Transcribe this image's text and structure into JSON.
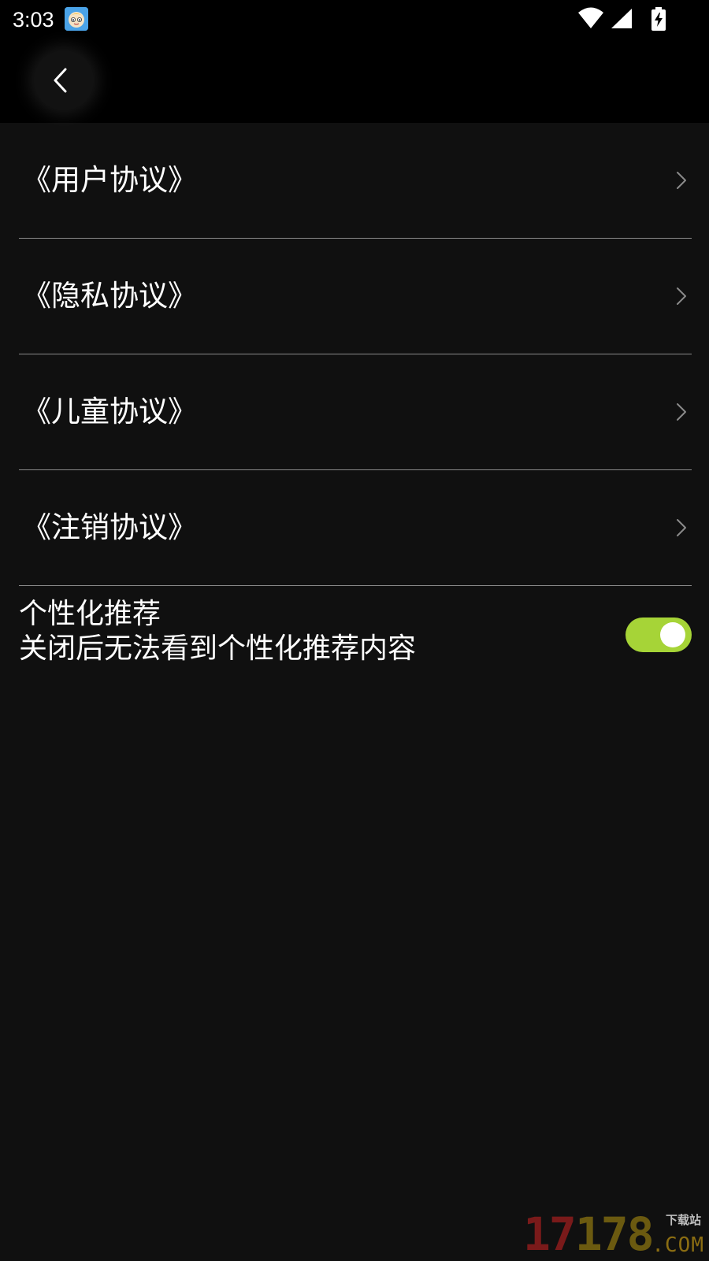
{
  "status_bar": {
    "time": "3:03",
    "app_icon": "baby-face-icon",
    "icons": [
      "wifi-icon",
      "signal-icon",
      "battery-charging-icon"
    ]
  },
  "top_bar": {
    "back_icon": "chevron-left-icon"
  },
  "agreements": [
    {
      "label": "《用户协议》",
      "icon": "chevron-right-icon"
    },
    {
      "label": "《隐私协议》",
      "icon": "chevron-right-icon"
    },
    {
      "label": "《儿童协议》",
      "icon": "chevron-right-icon"
    },
    {
      "label": "《注销协议》",
      "icon": "chevron-right-icon"
    }
  ],
  "personalized_recommendation": {
    "title": "个性化推荐",
    "subtitle": "关闭后无法看到个性化推荐内容",
    "enabled": true
  },
  "watermark": {
    "digits_a": "17",
    "digits_b": "178",
    "cn_text": "下载站",
    "suffix": ".COM"
  },
  "colors": {
    "background": "#101010",
    "bars": "#000000",
    "toggle_on": "#a6d437",
    "divider": "#8a8a8a",
    "text": "#ffffff"
  }
}
